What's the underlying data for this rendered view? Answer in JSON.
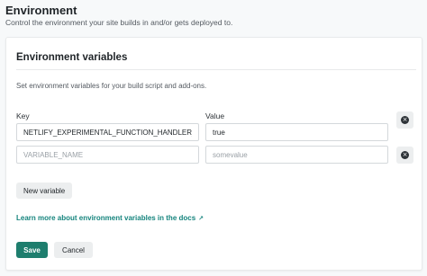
{
  "header": {
    "title": "Environment",
    "description": "Control the environment your site builds in and/or gets deployed to."
  },
  "card": {
    "title": "Environment variables",
    "description": "Set environment variables for your build script and add-ons.",
    "key_label": "Key",
    "value_label": "Value",
    "rows": [
      {
        "key": "NETLIFY_EXPERIMENTAL_FUNCTION_HANDLER_",
        "value": "true",
        "key_placeholder": "",
        "value_placeholder": ""
      },
      {
        "key": "",
        "value": "",
        "key_placeholder": "VARIABLE_NAME",
        "value_placeholder": "somevalue"
      }
    ],
    "remove_icon": "close-circle-icon",
    "new_variable_label": "New variable",
    "docs_link_label": "Learn more about environment variables in the docs",
    "docs_link_arrow": "↗",
    "save_label": "Save",
    "cancel_label": "Cancel"
  },
  "colors": {
    "primary": "#1e7e6e",
    "link": "#15847d",
    "background": "#f7f9fa"
  }
}
